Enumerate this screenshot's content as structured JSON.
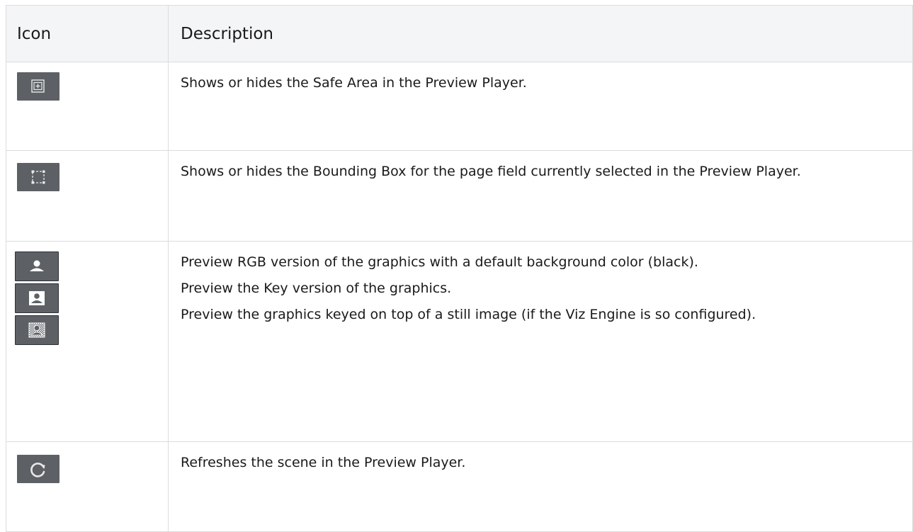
{
  "table": {
    "headers": {
      "icon": "Icon",
      "description": "Description"
    },
    "rows": [
      {
        "icon": "safe-area-icon",
        "descriptions": [
          "Shows or hides the Safe Area in the Preview Player."
        ]
      },
      {
        "icon": "bounding-box-icon",
        "descriptions": [
          "Shows or hides the Bounding Box for the page field currently selected in the Preview Player."
        ]
      },
      {
        "icons": [
          "rgb-preview-icon",
          "key-preview-icon",
          "still-image-preview-icon"
        ],
        "descriptions": [
          "Preview RGB version of the graphics with a default background color (black).",
          "Preview the Key version of the graphics.",
          "Preview the graphics keyed on top of a still image (if the Viz Engine is so configured)."
        ]
      },
      {
        "icon": "refresh-icon",
        "descriptions": [
          "Refreshes the scene in the Preview Player."
        ]
      }
    ]
  },
  "colors": {
    "header_bg": "#f4f5f7",
    "border": "#dcdcdc",
    "icon_bg": "#5d6165",
    "icon_fg": "#ffffff"
  }
}
